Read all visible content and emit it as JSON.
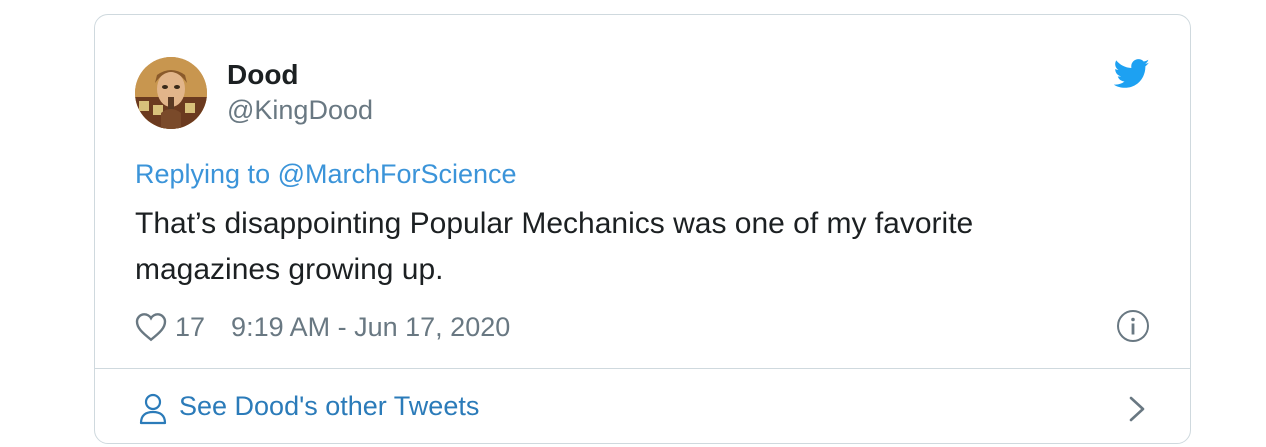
{
  "tweet": {
    "author": {
      "display_name": "Dood",
      "handle": "@KingDood",
      "avatar_icon": "avatar"
    },
    "brand_icon": "twitter-bird-icon",
    "reply_label": "Replying to @MarchForScience",
    "text": "That’s disappointing Popular Mechanics was one of my favorite magazines growing up.",
    "likes": "17",
    "timestamp": "9:19 AM - Jun 17, 2020",
    "footer_link": "See Dood's other Tweets"
  },
  "colors": {
    "brand_blue": "#1da1f2",
    "link_blue": "#3b94d9",
    "muted_gray": "#697882",
    "border": "#cfd9de"
  }
}
